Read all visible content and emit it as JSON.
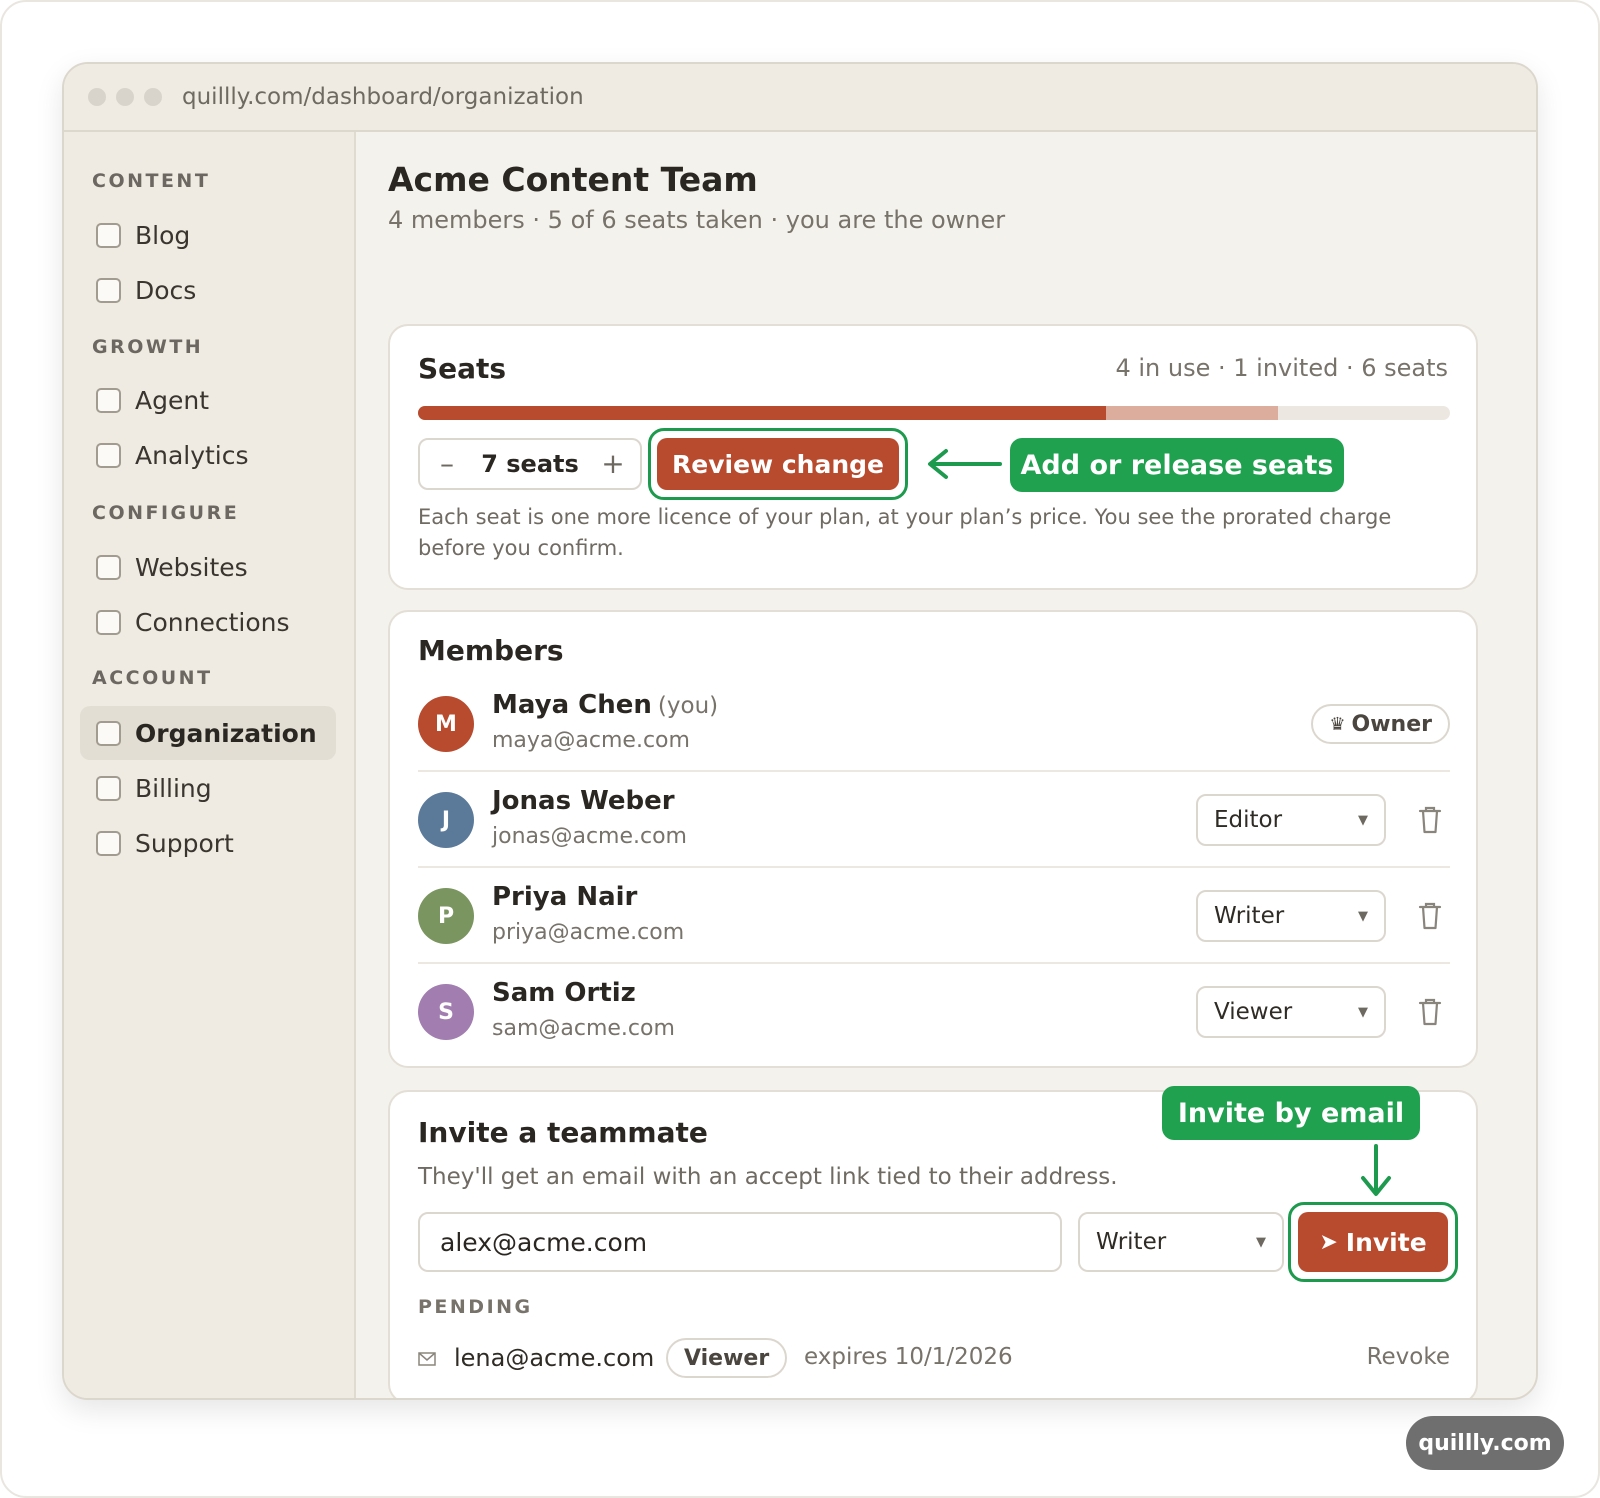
{
  "browser": {
    "url": "quillly.com/dashboard/organization"
  },
  "sidebar": {
    "sections": [
      {
        "title": "CONTENT",
        "items": [
          {
            "label": "Blog"
          },
          {
            "label": "Docs"
          }
        ]
      },
      {
        "title": "GROWTH",
        "items": [
          {
            "label": "Agent"
          },
          {
            "label": "Analytics"
          }
        ]
      },
      {
        "title": "CONFIGURE",
        "items": [
          {
            "label": "Websites"
          },
          {
            "label": "Connections"
          }
        ]
      },
      {
        "title": "ACCOUNT",
        "items": [
          {
            "label": "Organization",
            "active": true
          },
          {
            "label": "Billing"
          },
          {
            "label": "Support"
          }
        ]
      }
    ]
  },
  "org": {
    "name": "Acme Content Team",
    "summary": "4 members · 5 of 6 seats taken · you are the owner"
  },
  "seats": {
    "title": "Seats",
    "meta": "4 in use · 1 invited · 6 seats",
    "in_use": 4,
    "invited": 1,
    "total": 6,
    "stepper": {
      "minus": "–",
      "value": "7 seats",
      "plus": "+"
    },
    "review_button": "Review change",
    "callout": "Add or release seats",
    "help": "Each seat is one more licence of your plan, at your plan’s price. You see the prorated charge before you confirm."
  },
  "members": {
    "title": "Members",
    "you_label": "(you)",
    "owner_badge": "Owner",
    "rows": [
      {
        "initial": "M",
        "name": "Maya Chen",
        "email": "maya@acme.com",
        "is_you": true,
        "role": "Owner",
        "avatar_color": "#b84a2e"
      },
      {
        "initial": "J",
        "name": "Jonas Weber",
        "email": "jonas@acme.com",
        "role": "Editor",
        "avatar_color": "#5b7a9a"
      },
      {
        "initial": "P",
        "name": "Priya Nair",
        "email": "priya@acme.com",
        "role": "Writer",
        "avatar_color": "#7b9560"
      },
      {
        "initial": "S",
        "name": "Sam Ortiz",
        "email": "sam@acme.com",
        "role": "Viewer",
        "avatar_color": "#a17db0"
      }
    ]
  },
  "invite": {
    "title": "Invite a teammate",
    "subtitle": "They'll get an email with an accept link tied to their address.",
    "email_value": "alex@acme.com",
    "role": "Writer",
    "button": "Invite",
    "callout": "Invite by email",
    "pending_label": "PENDING",
    "pending": [
      {
        "email": "lena@acme.com",
        "role": "Viewer",
        "expires": "expires 10/1/2026",
        "action": "Revoke"
      }
    ]
  },
  "watermark": "quillly.com",
  "colors": {
    "accent": "#b84a2e",
    "callout": "#1fa150",
    "invited_segment": "#dcac9c"
  }
}
